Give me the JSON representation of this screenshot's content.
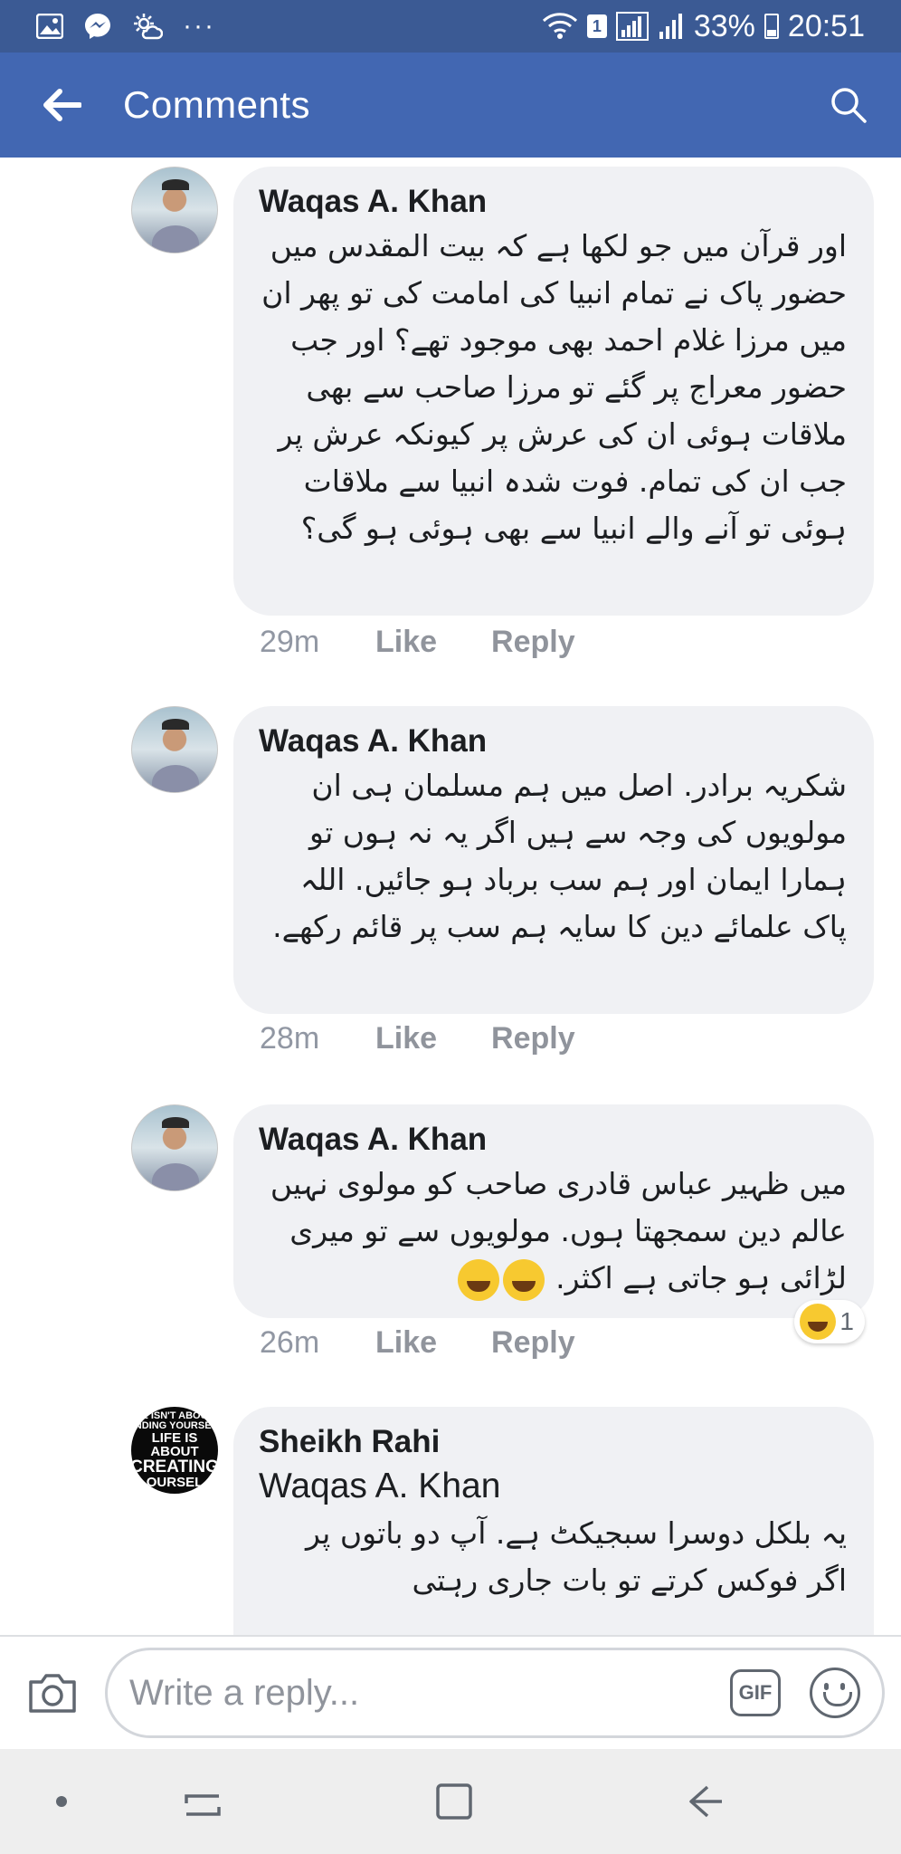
{
  "status_bar": {
    "battery": "33%",
    "time": "20:51",
    "sim_badge": "1",
    "more": "···"
  },
  "app_bar": {
    "title": "Comments"
  },
  "comments": [
    {
      "author": "Waqas A. Khan",
      "text": "اور قرآن میں جو لکھا ہے کہ بیت المقدس میں حضور پاک نے تمام انبیا کی امامت کی تو پھر ان میں مرزا غلام احمد بھی موجود تھے؟ اور جب حضور معراج پر گئے تو مرزا صاحب سے بھی ملاقات ہوئی ان کی عرش پر کیونکہ عرش پر جب ان کی تمام. فوت شدہ انبیا سے ملاقات ہوئی تو آنے والے انبیا سے بھی ہوئی ہو گی؟",
      "time": "29m",
      "like": "Like",
      "reply": "Reply"
    },
    {
      "author": "Waqas A. Khan",
      "text": "شکریہ برادر. اصل میں ہم مسلمان ہی ان مولویوں کی وجہ سے ہیں اگر یہ نہ ہوں تو ہمارا ایمان اور ہم سب برباد ہو جائیں. اللہ پاک علمائے دین کا سایہ ہم سب پر قائم رکھے.",
      "time": "28m",
      "like": "Like",
      "reply": "Reply"
    },
    {
      "author": "Waqas A. Khan",
      "text": "میں ظہیر عباس قادری صاحب کو مولوی نہیں عالم دین سمجھتا ہوں. مولویوں سے تو میری لڑائی ہو جاتی ہے اکثر.",
      "time": "26m",
      "like": "Like",
      "reply": "Reply",
      "reaction_count": "1"
    },
    {
      "author": "Sheikh Rahi",
      "mention": "Waqas A. Khan",
      "text": "یہ بلکل دوسرا سبجیکٹ ہے. آپ دو باتوں پر اگر فوکس کرتے تو بات جاری رہتی",
      "avatar_text": [
        "E ISN'T ABOU",
        "INDING YOURSEL",
        "LIFE IS ABOUT",
        "CREATING",
        "OURSEL"
      ]
    }
  ],
  "reply_bar": {
    "placeholder": "Write a reply...",
    "gif_label": "GIF"
  }
}
